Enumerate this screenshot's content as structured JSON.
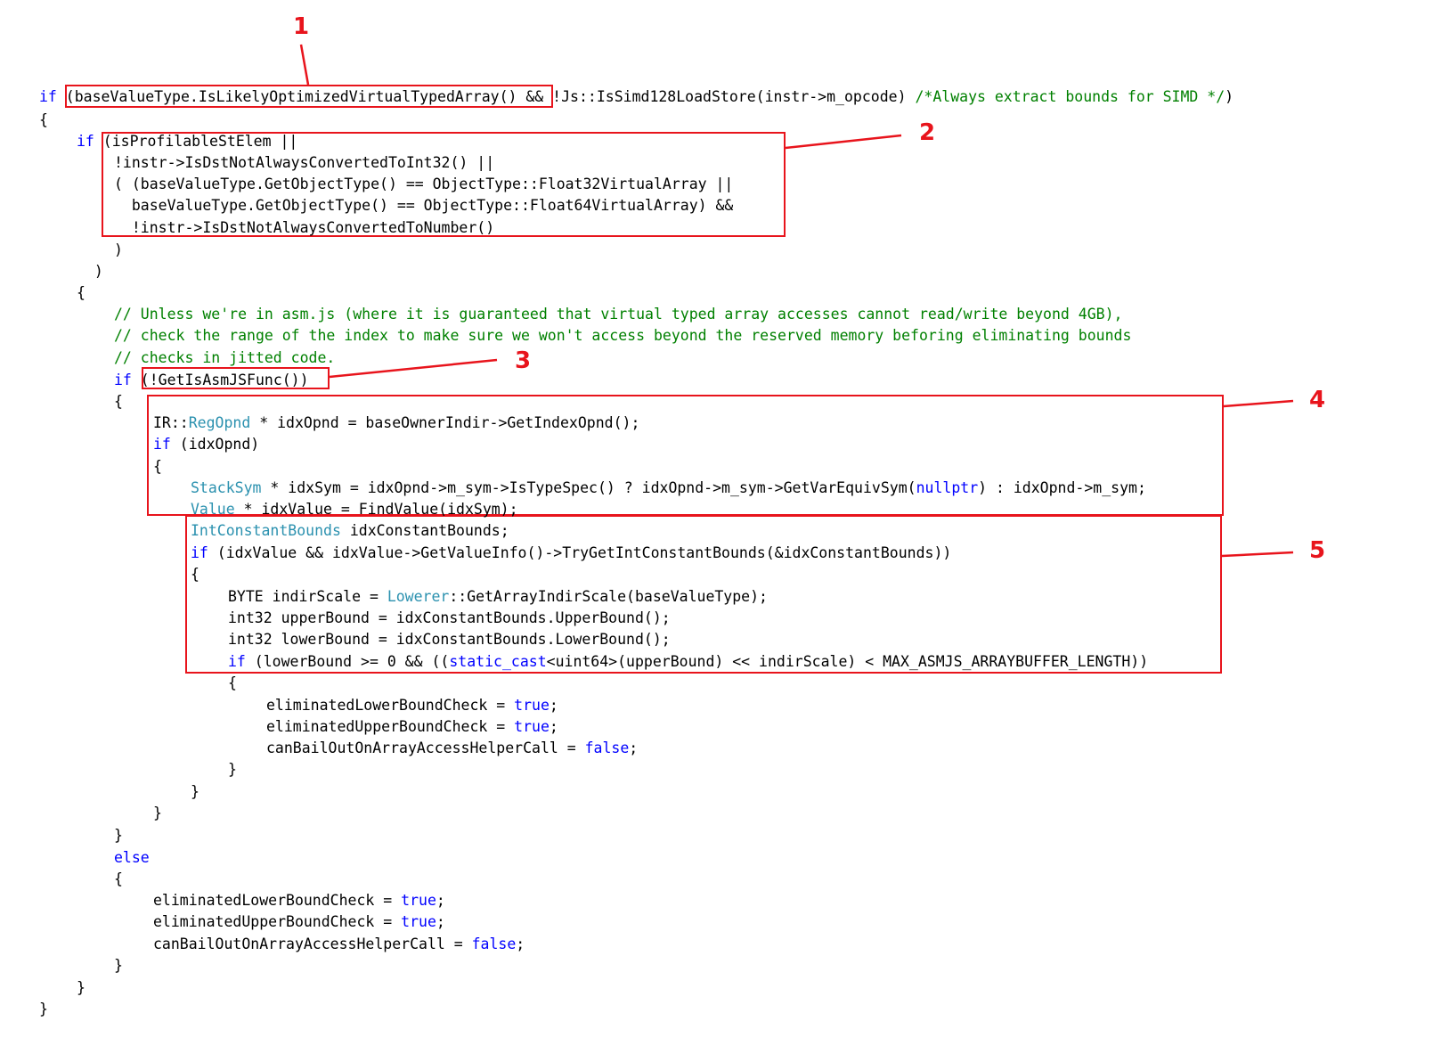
{
  "colors": {
    "keyword": "#0000ff",
    "type": "#2b91af",
    "comment": "#008000",
    "text": "#000000",
    "highlight": "#e8141c"
  },
  "code_lines": [
    {
      "indent": 0,
      "tokens": [
        {
          "t": "if",
          "k": "kw"
        },
        {
          "t": " (baseValueType.IsLikelyOptimizedVirtualTypedArray() && !Js::IsSimd128LoadStore(instr->m_opcode) "
        },
        {
          "t": "/*Always extract bounds for SIMD */",
          "k": "cm"
        },
        {
          "t": ")"
        }
      ]
    },
    {
      "indent": 0,
      "tokens": [
        {
          "t": "{"
        }
      ]
    },
    {
      "indent": 1,
      "tokens": [
        {
          "t": "if",
          "k": "kw"
        },
        {
          "t": " (isProfilableStElem ||"
        }
      ]
    },
    {
      "indent": 2,
      "tokens": [
        {
          "t": "!instr->IsDstNotAlwaysConvertedToInt32() ||"
        }
      ]
    },
    {
      "indent": 2,
      "tokens": [
        {
          "t": "( (baseValueType.GetObjectType() == ObjectType::Float32VirtualArray ||"
        }
      ]
    },
    {
      "indent": 2,
      "tokens": [
        {
          "t": "  baseValueType.GetObjectType() == ObjectType::Float64VirtualArray) &&"
        }
      ]
    },
    {
      "indent": 2,
      "tokens": [
        {
          "t": "  !instr->IsDstNotAlwaysConvertedToNumber()"
        }
      ]
    },
    {
      "indent": 2,
      "tokens": [
        {
          "t": ")"
        }
      ]
    },
    {
      "indent": 1,
      "tokens": [
        {
          "t": "  )"
        }
      ]
    },
    {
      "indent": 1,
      "tokens": [
        {
          "t": "{"
        }
      ]
    },
    {
      "indent": 2,
      "tokens": [
        {
          "t": "// Unless we're in asm.js (where it is guaranteed that virtual typed array accesses cannot read/write beyond 4GB),",
          "k": "cm"
        }
      ]
    },
    {
      "indent": 2,
      "tokens": [
        {
          "t": "// check the range of the index to make sure we won't access beyond the reserved memory beforing eliminating bounds",
          "k": "cm"
        }
      ]
    },
    {
      "indent": 2,
      "tokens": [
        {
          "t": "// checks in jitted code.",
          "k": "cm"
        }
      ]
    },
    {
      "indent": 2,
      "tokens": [
        {
          "t": "if",
          "k": "kw"
        },
        {
          "t": " (!GetIsAsmJSFunc())"
        }
      ]
    },
    {
      "indent": 2,
      "tokens": [
        {
          "t": "{"
        }
      ]
    },
    {
      "indent": 3,
      "tokens": [
        {
          "t": "IR::"
        },
        {
          "t": "RegOpnd",
          "k": "ty"
        },
        {
          "t": " * idxOpnd = baseOwnerIndir->GetIndexOpnd();"
        }
      ]
    },
    {
      "indent": 3,
      "tokens": [
        {
          "t": "if",
          "k": "kw"
        },
        {
          "t": " (idxOpnd)"
        }
      ]
    },
    {
      "indent": 3,
      "tokens": [
        {
          "t": "{"
        }
      ]
    },
    {
      "indent": 4,
      "tokens": [
        {
          "t": "StackSym",
          "k": "ty"
        },
        {
          "t": " * idxSym = idxOpnd->m_sym->IsTypeSpec() ? idxOpnd->m_sym->GetVarEquivSym("
        },
        {
          "t": "nullptr",
          "k": "kw"
        },
        {
          "t": ") : idxOpnd->m_sym;"
        }
      ]
    },
    {
      "indent": 4,
      "tokens": [
        {
          "t": "Value",
          "k": "ty"
        },
        {
          "t": " * idxValue = FindValue(idxSym);"
        }
      ]
    },
    {
      "indent": 4,
      "tokens": [
        {
          "t": "IntConstantBounds",
          "k": "ty"
        },
        {
          "t": " idxConstantBounds;"
        }
      ]
    },
    {
      "indent": 4,
      "tokens": [
        {
          "t": "if",
          "k": "kw"
        },
        {
          "t": " (idxValue && idxValue->GetValueInfo()->TryGetIntConstantBounds(&idxConstantBounds))"
        }
      ]
    },
    {
      "indent": 4,
      "tokens": [
        {
          "t": "{"
        }
      ]
    },
    {
      "indent": 5,
      "tokens": [
        {
          "t": "BYTE indirScale = "
        },
        {
          "t": "Lowerer",
          "k": "ty"
        },
        {
          "t": "::GetArrayIndirScale(baseValueType);"
        }
      ]
    },
    {
      "indent": 5,
      "tokens": [
        {
          "t": "int32 upperBound = idxConstantBounds.UpperBound();"
        }
      ]
    },
    {
      "indent": 5,
      "tokens": [
        {
          "t": "int32 lowerBound = idxConstantBounds.LowerBound();"
        }
      ]
    },
    {
      "indent": 5,
      "tokens": [
        {
          "t": "if",
          "k": "kw"
        },
        {
          "t": " (lowerBound >= 0 && (("
        },
        {
          "t": "static_cast",
          "k": "kw"
        },
        {
          "t": "<uint64>(upperBound) << indirScale) < MAX_ASMJS_ARRAYBUFFER_LENGTH))"
        }
      ]
    },
    {
      "indent": 5,
      "tokens": [
        {
          "t": "{"
        }
      ]
    },
    {
      "indent": 6,
      "tokens": [
        {
          "t": "eliminatedLowerBoundCheck = "
        },
        {
          "t": "true",
          "k": "kw"
        },
        {
          "t": ";"
        }
      ]
    },
    {
      "indent": 6,
      "tokens": [
        {
          "t": "eliminatedUpperBoundCheck = "
        },
        {
          "t": "true",
          "k": "kw"
        },
        {
          "t": ";"
        }
      ]
    },
    {
      "indent": 6,
      "tokens": [
        {
          "t": "canBailOutOnArrayAccessHelperCall = "
        },
        {
          "t": "false",
          "k": "kw"
        },
        {
          "t": ";"
        }
      ]
    },
    {
      "indent": 5,
      "tokens": [
        {
          "t": "}"
        }
      ]
    },
    {
      "indent": 4,
      "tokens": [
        {
          "t": "}"
        }
      ]
    },
    {
      "indent": 3,
      "tokens": [
        {
          "t": "}"
        }
      ]
    },
    {
      "indent": 2,
      "tokens": [
        {
          "t": "}"
        }
      ]
    },
    {
      "indent": 2,
      "tokens": [
        {
          "t": "else",
          "k": "kw"
        }
      ]
    },
    {
      "indent": 2,
      "tokens": [
        {
          "t": "{"
        }
      ]
    },
    {
      "indent": 3,
      "tokens": [
        {
          "t": "eliminatedLowerBoundCheck = "
        },
        {
          "t": "true",
          "k": "kw"
        },
        {
          "t": ";"
        }
      ]
    },
    {
      "indent": 3,
      "tokens": [
        {
          "t": "eliminatedUpperBoundCheck = "
        },
        {
          "t": "true",
          "k": "kw"
        },
        {
          "t": ";"
        }
      ]
    },
    {
      "indent": 3,
      "tokens": [
        {
          "t": "canBailOutOnArrayAccessHelperCall = "
        },
        {
          "t": "false",
          "k": "kw"
        },
        {
          "t": ";"
        }
      ]
    },
    {
      "indent": 2,
      "tokens": [
        {
          "t": "}"
        }
      ]
    },
    {
      "indent": 1,
      "tokens": [
        {
          "t": "}"
        }
      ]
    },
    {
      "indent": 0,
      "tokens": [
        {
          "t": "}"
        }
      ]
    }
  ],
  "callouts": [
    {
      "label": "1"
    },
    {
      "label": "2"
    },
    {
      "label": "3"
    },
    {
      "label": "4"
    },
    {
      "label": "5"
    }
  ]
}
